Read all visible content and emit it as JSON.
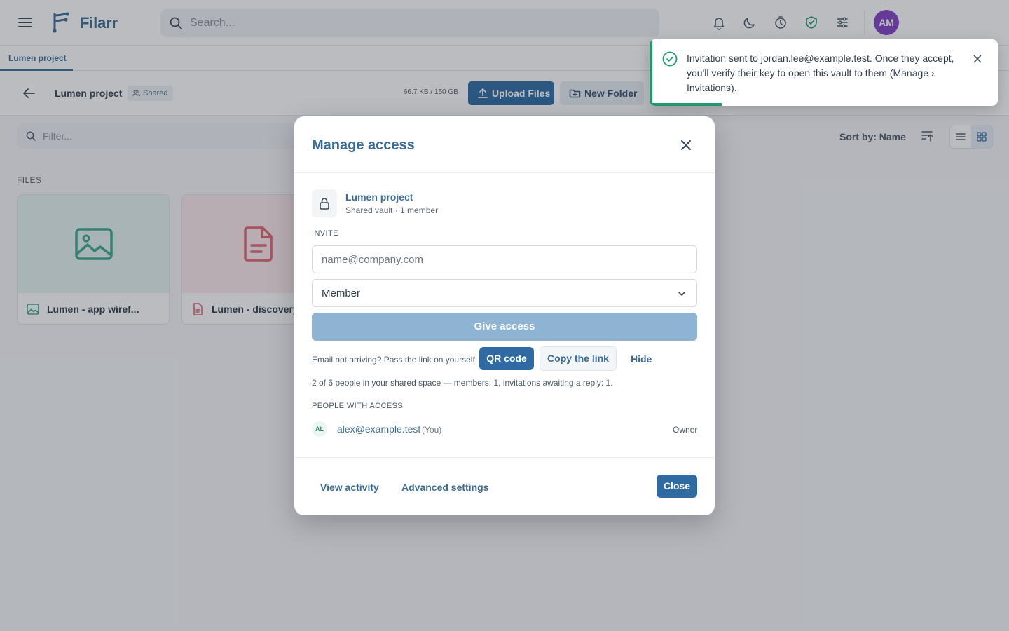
{
  "app": {
    "brand": "Filarr",
    "search_placeholder": "Search...",
    "avatar_initials": "AM",
    "accent_color": "#2f6aa3",
    "toolbar_icons": [
      "bell-icon",
      "moon-icon",
      "timer-icon",
      "shield-check-icon",
      "sliders-icon"
    ]
  },
  "tabs": [
    {
      "label": "Lumen project",
      "active": true
    }
  ],
  "header": {
    "title": "Lumen project",
    "badge": "Shared",
    "storage": "66.7 KB / 150 GB",
    "upload_label": "Upload Files",
    "new_folder_label": "New Folder"
  },
  "filter": {
    "placeholder": "Filter...",
    "sort_label": "Sort by: Name"
  },
  "files": {
    "section_label": "FILES",
    "items": [
      {
        "name": "Lumen - app wiref...",
        "type": "image"
      },
      {
        "name": "Lumen - discovery",
        "type": "document"
      }
    ]
  },
  "toast": {
    "message": "Invitation sent to jordan.lee@example.test. Once they accept, you'll verify their key to open this vault to them (Manage › Invitations).",
    "status_color": "#1f9a6b"
  },
  "modal": {
    "title": "Manage access",
    "vault": {
      "name": "Lumen project",
      "meta": "Shared vault · 1 member"
    },
    "invite_label": "INVITE",
    "email_placeholder": "name@company.com",
    "role_value": "Member",
    "give_access_label": "Give access",
    "link_hint": "Email not arriving? Pass the link on yourself:",
    "qr_label": "QR code",
    "copy_link_label": "Copy the link",
    "hide_label": "Hide",
    "capacity_text": "2 of 6 people in your shared space — members: 1, invitations awaiting a reply: 1.",
    "people_label": "PEOPLE WITH ACCESS",
    "people": [
      {
        "initials": "AL",
        "email": "alex@example.test",
        "you": "(You)",
        "role": "Owner"
      }
    ],
    "view_activity_label": "View activity",
    "advanced_settings_label": "Advanced settings",
    "close_label": "Close"
  }
}
